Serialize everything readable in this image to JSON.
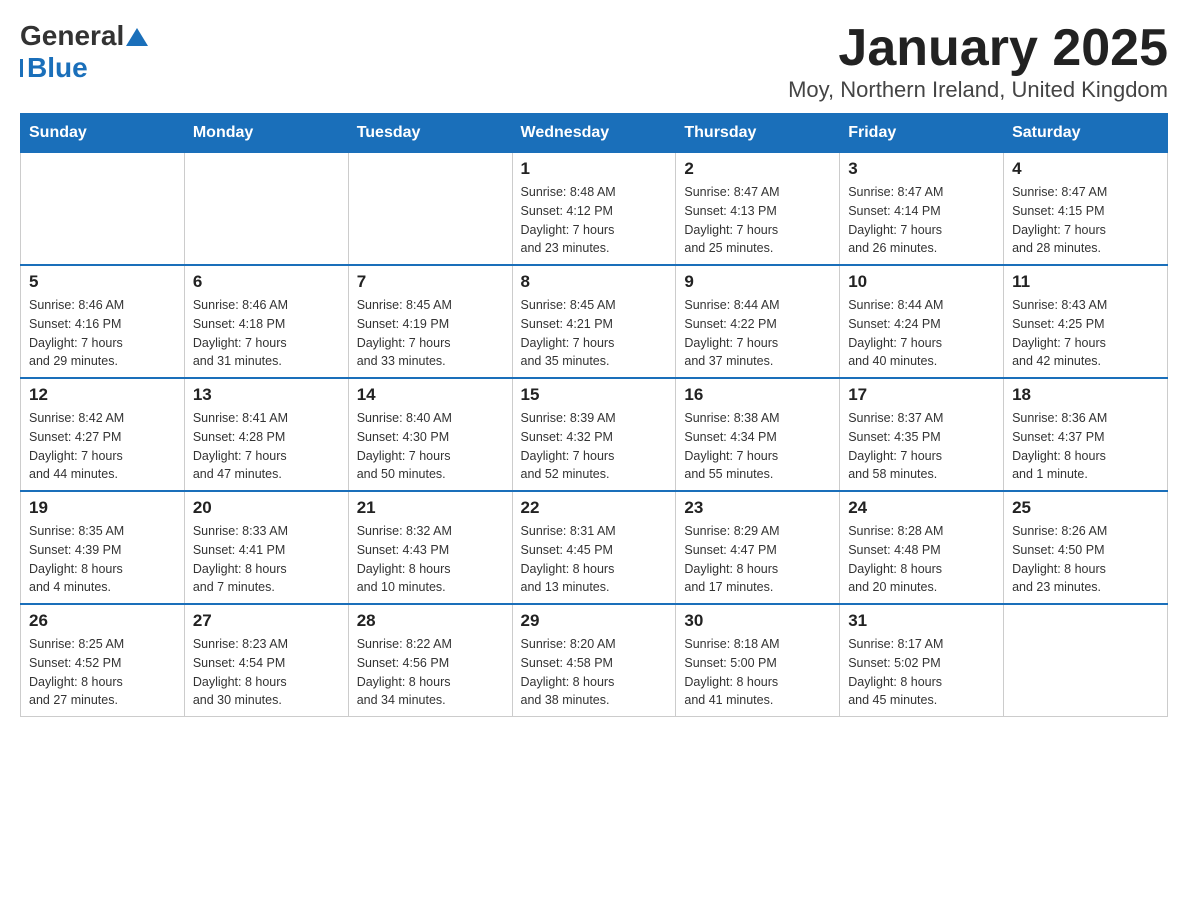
{
  "logo": {
    "name1": "General",
    "name2": "Blue"
  },
  "title": "January 2025",
  "subtitle": "Moy, Northern Ireland, United Kingdom",
  "columns": [
    "Sunday",
    "Monday",
    "Tuesday",
    "Wednesday",
    "Thursday",
    "Friday",
    "Saturday"
  ],
  "weeks": [
    [
      {
        "day": "",
        "info": ""
      },
      {
        "day": "",
        "info": ""
      },
      {
        "day": "",
        "info": ""
      },
      {
        "day": "1",
        "info": "Sunrise: 8:48 AM\nSunset: 4:12 PM\nDaylight: 7 hours\nand 23 minutes."
      },
      {
        "day": "2",
        "info": "Sunrise: 8:47 AM\nSunset: 4:13 PM\nDaylight: 7 hours\nand 25 minutes."
      },
      {
        "day": "3",
        "info": "Sunrise: 8:47 AM\nSunset: 4:14 PM\nDaylight: 7 hours\nand 26 minutes."
      },
      {
        "day": "4",
        "info": "Sunrise: 8:47 AM\nSunset: 4:15 PM\nDaylight: 7 hours\nand 28 minutes."
      }
    ],
    [
      {
        "day": "5",
        "info": "Sunrise: 8:46 AM\nSunset: 4:16 PM\nDaylight: 7 hours\nand 29 minutes."
      },
      {
        "day": "6",
        "info": "Sunrise: 8:46 AM\nSunset: 4:18 PM\nDaylight: 7 hours\nand 31 minutes."
      },
      {
        "day": "7",
        "info": "Sunrise: 8:45 AM\nSunset: 4:19 PM\nDaylight: 7 hours\nand 33 minutes."
      },
      {
        "day": "8",
        "info": "Sunrise: 8:45 AM\nSunset: 4:21 PM\nDaylight: 7 hours\nand 35 minutes."
      },
      {
        "day": "9",
        "info": "Sunrise: 8:44 AM\nSunset: 4:22 PM\nDaylight: 7 hours\nand 37 minutes."
      },
      {
        "day": "10",
        "info": "Sunrise: 8:44 AM\nSunset: 4:24 PM\nDaylight: 7 hours\nand 40 minutes."
      },
      {
        "day": "11",
        "info": "Sunrise: 8:43 AM\nSunset: 4:25 PM\nDaylight: 7 hours\nand 42 minutes."
      }
    ],
    [
      {
        "day": "12",
        "info": "Sunrise: 8:42 AM\nSunset: 4:27 PM\nDaylight: 7 hours\nand 44 minutes."
      },
      {
        "day": "13",
        "info": "Sunrise: 8:41 AM\nSunset: 4:28 PM\nDaylight: 7 hours\nand 47 minutes."
      },
      {
        "day": "14",
        "info": "Sunrise: 8:40 AM\nSunset: 4:30 PM\nDaylight: 7 hours\nand 50 minutes."
      },
      {
        "day": "15",
        "info": "Sunrise: 8:39 AM\nSunset: 4:32 PM\nDaylight: 7 hours\nand 52 minutes."
      },
      {
        "day": "16",
        "info": "Sunrise: 8:38 AM\nSunset: 4:34 PM\nDaylight: 7 hours\nand 55 minutes."
      },
      {
        "day": "17",
        "info": "Sunrise: 8:37 AM\nSunset: 4:35 PM\nDaylight: 7 hours\nand 58 minutes."
      },
      {
        "day": "18",
        "info": "Sunrise: 8:36 AM\nSunset: 4:37 PM\nDaylight: 8 hours\nand 1 minute."
      }
    ],
    [
      {
        "day": "19",
        "info": "Sunrise: 8:35 AM\nSunset: 4:39 PM\nDaylight: 8 hours\nand 4 minutes."
      },
      {
        "day": "20",
        "info": "Sunrise: 8:33 AM\nSunset: 4:41 PM\nDaylight: 8 hours\nand 7 minutes."
      },
      {
        "day": "21",
        "info": "Sunrise: 8:32 AM\nSunset: 4:43 PM\nDaylight: 8 hours\nand 10 minutes."
      },
      {
        "day": "22",
        "info": "Sunrise: 8:31 AM\nSunset: 4:45 PM\nDaylight: 8 hours\nand 13 minutes."
      },
      {
        "day": "23",
        "info": "Sunrise: 8:29 AM\nSunset: 4:47 PM\nDaylight: 8 hours\nand 17 minutes."
      },
      {
        "day": "24",
        "info": "Sunrise: 8:28 AM\nSunset: 4:48 PM\nDaylight: 8 hours\nand 20 minutes."
      },
      {
        "day": "25",
        "info": "Sunrise: 8:26 AM\nSunset: 4:50 PM\nDaylight: 8 hours\nand 23 minutes."
      }
    ],
    [
      {
        "day": "26",
        "info": "Sunrise: 8:25 AM\nSunset: 4:52 PM\nDaylight: 8 hours\nand 27 minutes."
      },
      {
        "day": "27",
        "info": "Sunrise: 8:23 AM\nSunset: 4:54 PM\nDaylight: 8 hours\nand 30 minutes."
      },
      {
        "day": "28",
        "info": "Sunrise: 8:22 AM\nSunset: 4:56 PM\nDaylight: 8 hours\nand 34 minutes."
      },
      {
        "day": "29",
        "info": "Sunrise: 8:20 AM\nSunset: 4:58 PM\nDaylight: 8 hours\nand 38 minutes."
      },
      {
        "day": "30",
        "info": "Sunrise: 8:18 AM\nSunset: 5:00 PM\nDaylight: 8 hours\nand 41 minutes."
      },
      {
        "day": "31",
        "info": "Sunrise: 8:17 AM\nSunset: 5:02 PM\nDaylight: 8 hours\nand 45 minutes."
      },
      {
        "day": "",
        "info": ""
      }
    ]
  ]
}
